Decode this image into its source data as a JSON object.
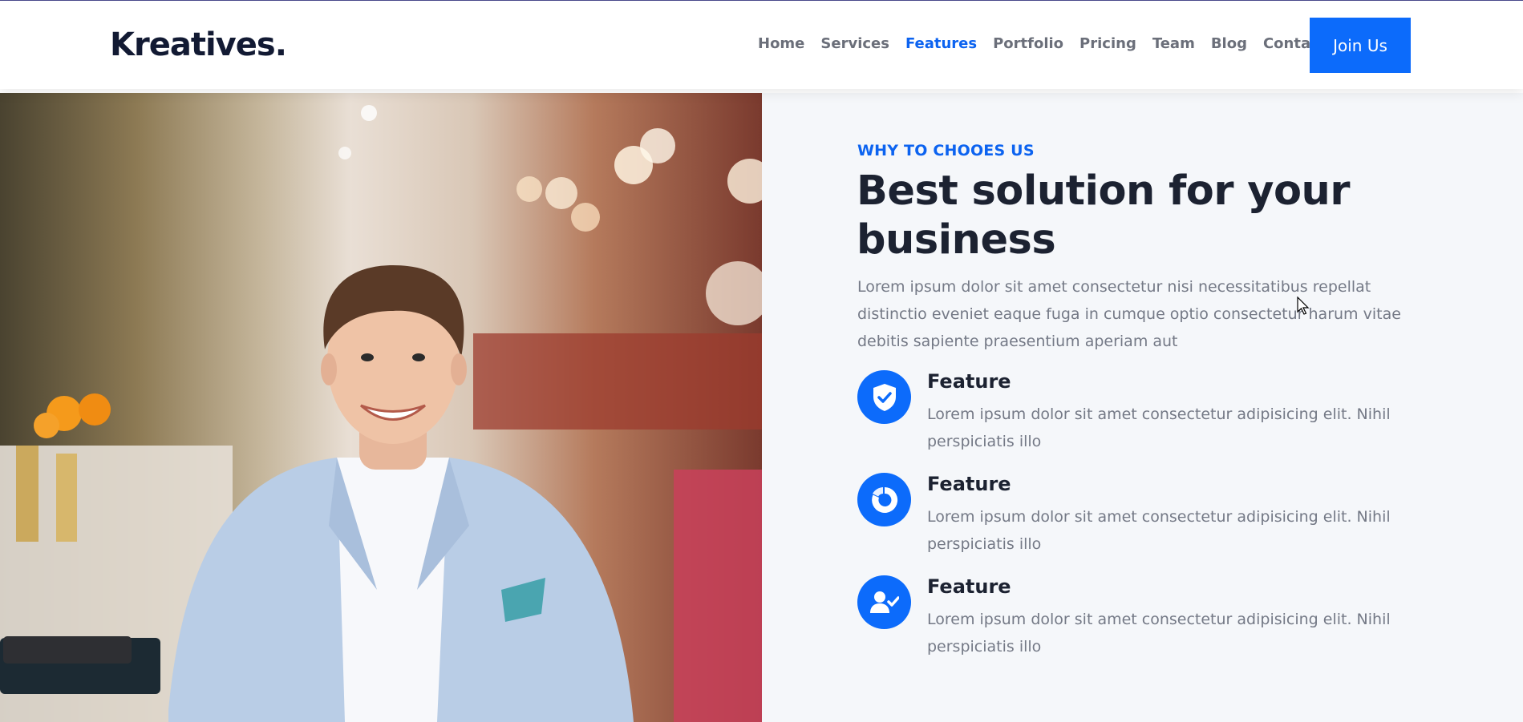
{
  "brand": {
    "logo": "Kreatives."
  },
  "nav": {
    "items": [
      {
        "label": "Home",
        "active": false
      },
      {
        "label": "Services",
        "active": false
      },
      {
        "label": "Features",
        "active": true
      },
      {
        "label": "Portfolio",
        "active": false
      },
      {
        "label": "Pricing",
        "active": false
      },
      {
        "label": "Team",
        "active": false
      },
      {
        "label": "Blog",
        "active": false
      },
      {
        "label": "Contact",
        "active": false
      }
    ],
    "cta_label": "Join Us"
  },
  "hero_image": {
    "description_icon": "photo-person-restaurant"
  },
  "section": {
    "eyebrow": "WHY TO CHOOES US",
    "heading": "Best solution for your business",
    "lead": "Lorem ipsum dolor sit amet consectetur nisi necessitatibus repellat distinctio eveniet eaque fuga in cumque optio consectetur harum vitae debitis sapiente praesentium aperiam aut"
  },
  "features": [
    {
      "icon": "shield-check-icon",
      "title": "Feature",
      "text": "Lorem ipsum dolor sit amet consectetur adipisicing elit. Nihil perspiciatis illo"
    },
    {
      "icon": "donut-chart-icon",
      "title": "Feature",
      "text": "Lorem ipsum dolor sit amet consectetur adipisicing elit. Nihil perspiciatis illo"
    },
    {
      "icon": "user-check-icon",
      "title": "Feature",
      "text": "Lorem ipsum dolor sit amet consectetur adipisicing elit. Nihil perspiciatis illo"
    }
  ],
  "colors": {
    "accent": "#0c6bfb",
    "heading": "#1c2231",
    "body_text": "#747986",
    "section_bg": "#f5f7fa"
  }
}
